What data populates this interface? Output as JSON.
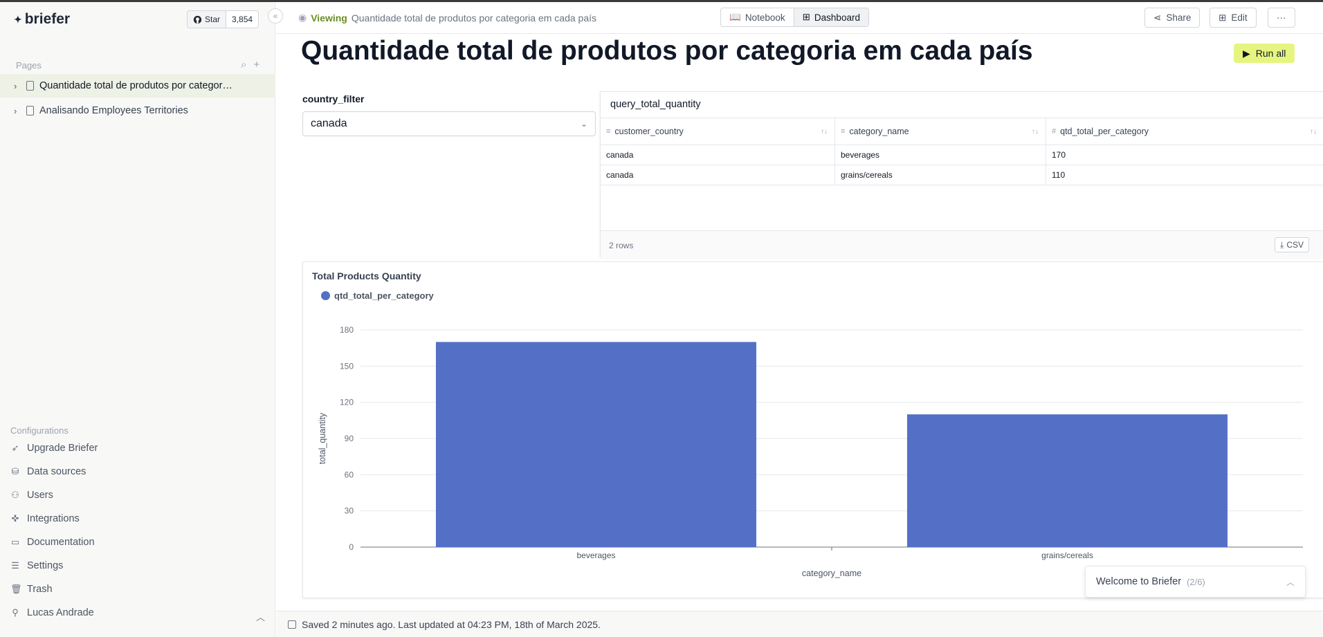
{
  "app": {
    "name": "briefer"
  },
  "github": {
    "star_label": "Star",
    "count": "3,854"
  },
  "sidebar": {
    "pages_heading": "Pages",
    "pages": [
      {
        "label": "Quantidade total de produtos por categoria em cada país",
        "active": true
      },
      {
        "label": "Analisando Employees Territories",
        "active": false
      }
    ],
    "config_heading": "Configurations",
    "items": [
      {
        "label": "Upgrade Briefer",
        "icon": "rocket-icon"
      },
      {
        "label": "Data sources",
        "icon": "database-icon"
      },
      {
        "label": "Users",
        "icon": "users-icon"
      },
      {
        "label": "Integrations",
        "icon": "puzzle-icon"
      },
      {
        "label": "Documentation",
        "icon": "book-icon"
      },
      {
        "label": "Settings",
        "icon": "sliders-icon"
      },
      {
        "label": "Trash",
        "icon": "trash-icon"
      }
    ],
    "user": "Lucas Andrade"
  },
  "topbar": {
    "viewing_label": "Viewing",
    "viewing_title": "Quantidade total de produtos por categoria em cada país",
    "notebook": "Notebook",
    "dashboard": "Dashboard",
    "share": "Share",
    "edit": "Edit",
    "more": "···"
  },
  "page": {
    "title": "Quantidade total de produtos por categoria em cada país",
    "run_all": "Run all"
  },
  "filter": {
    "label": "country_filter",
    "value": "canada"
  },
  "query": {
    "name": "query_total_quantity",
    "columns": [
      {
        "name": "customer_country",
        "type_icon": "≡"
      },
      {
        "name": "category_name",
        "type_icon": "≡"
      },
      {
        "name": "qtd_total_per_category",
        "type_icon": "#"
      }
    ],
    "rows": [
      [
        "canada",
        "beverages",
        "170"
      ],
      [
        "canada",
        "grains/cereals",
        "110"
      ]
    ],
    "row_count": "2 rows",
    "csv": "CSV"
  },
  "chart_data": {
    "type": "bar",
    "title": "Total Products Quantity",
    "categories": [
      "beverages",
      "grains/cereals"
    ],
    "series": [
      {
        "name": "qtd_total_per_category",
        "values": [
          170,
          110
        ],
        "color": "#5470c6"
      }
    ],
    "xlabel": "category_name",
    "ylabel": "total_quantity",
    "ylim": [
      0,
      180
    ],
    "yticks": [
      0,
      30,
      60,
      90,
      120,
      150,
      180
    ],
    "grid": true,
    "legend": "top-left"
  },
  "welcome": {
    "label": "Welcome to Briefer",
    "step": "(2/6)"
  },
  "status": {
    "text": "Saved 2 minutes ago. Last updated at 04:23 PM, 18th of March 2025."
  }
}
